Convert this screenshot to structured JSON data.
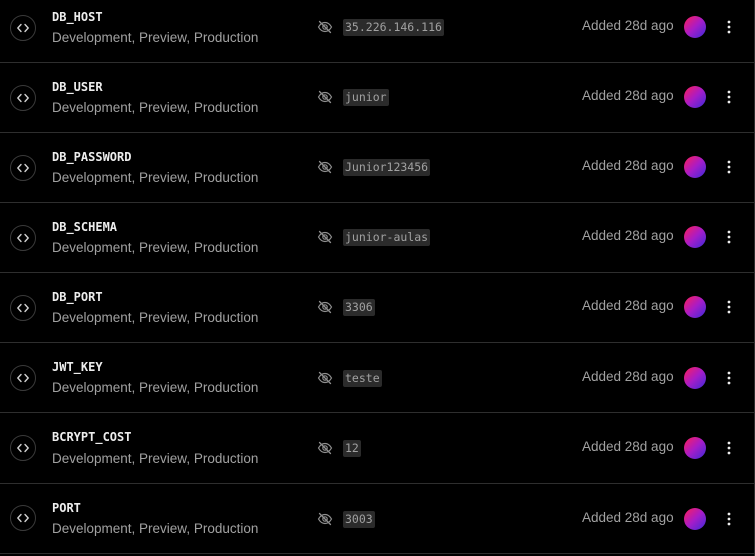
{
  "icons": {
    "row_icon": "code-icon",
    "value_state_icon": "eye-off-icon",
    "menu_icon": "more-vertical-icon"
  },
  "colors": {
    "background": "#000000",
    "divider": "#2e2e2e",
    "text_primary": "#ededed",
    "text_secondary": "#a1a1a1",
    "value_chip": "#2b2b2b"
  },
  "variables": [
    {
      "name": "DB_HOST",
      "environments": "Development, Preview, Production",
      "value": "35.226.146.116",
      "added": "Added 28d ago"
    },
    {
      "name": "DB_USER",
      "environments": "Development, Preview, Production",
      "value": "junior",
      "added": "Added 28d ago"
    },
    {
      "name": "DB_PASSWORD",
      "environments": "Development, Preview, Production",
      "value": "Junior123456",
      "added": "Added 28d ago"
    },
    {
      "name": "DB_SCHEMA",
      "environments": "Development, Preview, Production",
      "value": "junior-aulas",
      "added": "Added 28d ago"
    },
    {
      "name": "DB_PORT",
      "environments": "Development, Preview, Production",
      "value": "3306",
      "added": "Added 28d ago"
    },
    {
      "name": "JWT_KEY",
      "environments": "Development, Preview, Production",
      "value": "teste",
      "added": "Added 28d ago"
    },
    {
      "name": "BCRYPT_COST",
      "environments": "Development, Preview, Production",
      "value": "12",
      "added": "Added 28d ago"
    },
    {
      "name": "PORT",
      "environments": "Development, Preview, Production",
      "value": "3003",
      "added": "Added 28d ago"
    }
  ]
}
